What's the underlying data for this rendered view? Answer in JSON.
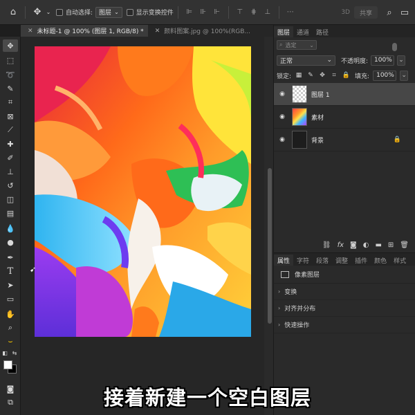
{
  "options_bar": {
    "auto_select_label": "自动选择:",
    "auto_select_value": "图层",
    "show_transform_label": "显示变换控件",
    "mode_3d": "3D",
    "share_label": "共享"
  },
  "tabs": [
    {
      "label": "未标题-1 @ 100% (图层 1, RGB/8) *",
      "active": true
    },
    {
      "label": "颜料图案.jpg @ 100%(RGB...",
      "active": false
    }
  ],
  "layers_panel": {
    "tabs": [
      "图层",
      "通道",
      "路径"
    ],
    "filter_placeholder": "选定",
    "blend_mode": "正常",
    "opacity_label": "不透明度:",
    "opacity_value": "100%",
    "lock_label": "锁定:",
    "fill_label": "填充:",
    "fill_value": "100%",
    "layers": [
      {
        "name": "图层 1",
        "selected": true,
        "thumb": "transparent",
        "locked": false
      },
      {
        "name": "素材",
        "selected": false,
        "thumb": "art",
        "locked": false
      },
      {
        "name": "背景",
        "selected": false,
        "thumb": "dark",
        "locked": true
      }
    ]
  },
  "properties_panel": {
    "tabs": [
      "属性",
      "字符",
      "段落",
      "调整",
      "插件",
      "颜色",
      "样式"
    ],
    "pixel_layer_label": "像素图层",
    "sections": [
      "变换",
      "对齐并分布",
      "快速操作"
    ]
  },
  "subtitle": "接着新建一个空白图层",
  "colors": {
    "accent_fg": "#ffffff",
    "accent_bg": "#000000"
  }
}
